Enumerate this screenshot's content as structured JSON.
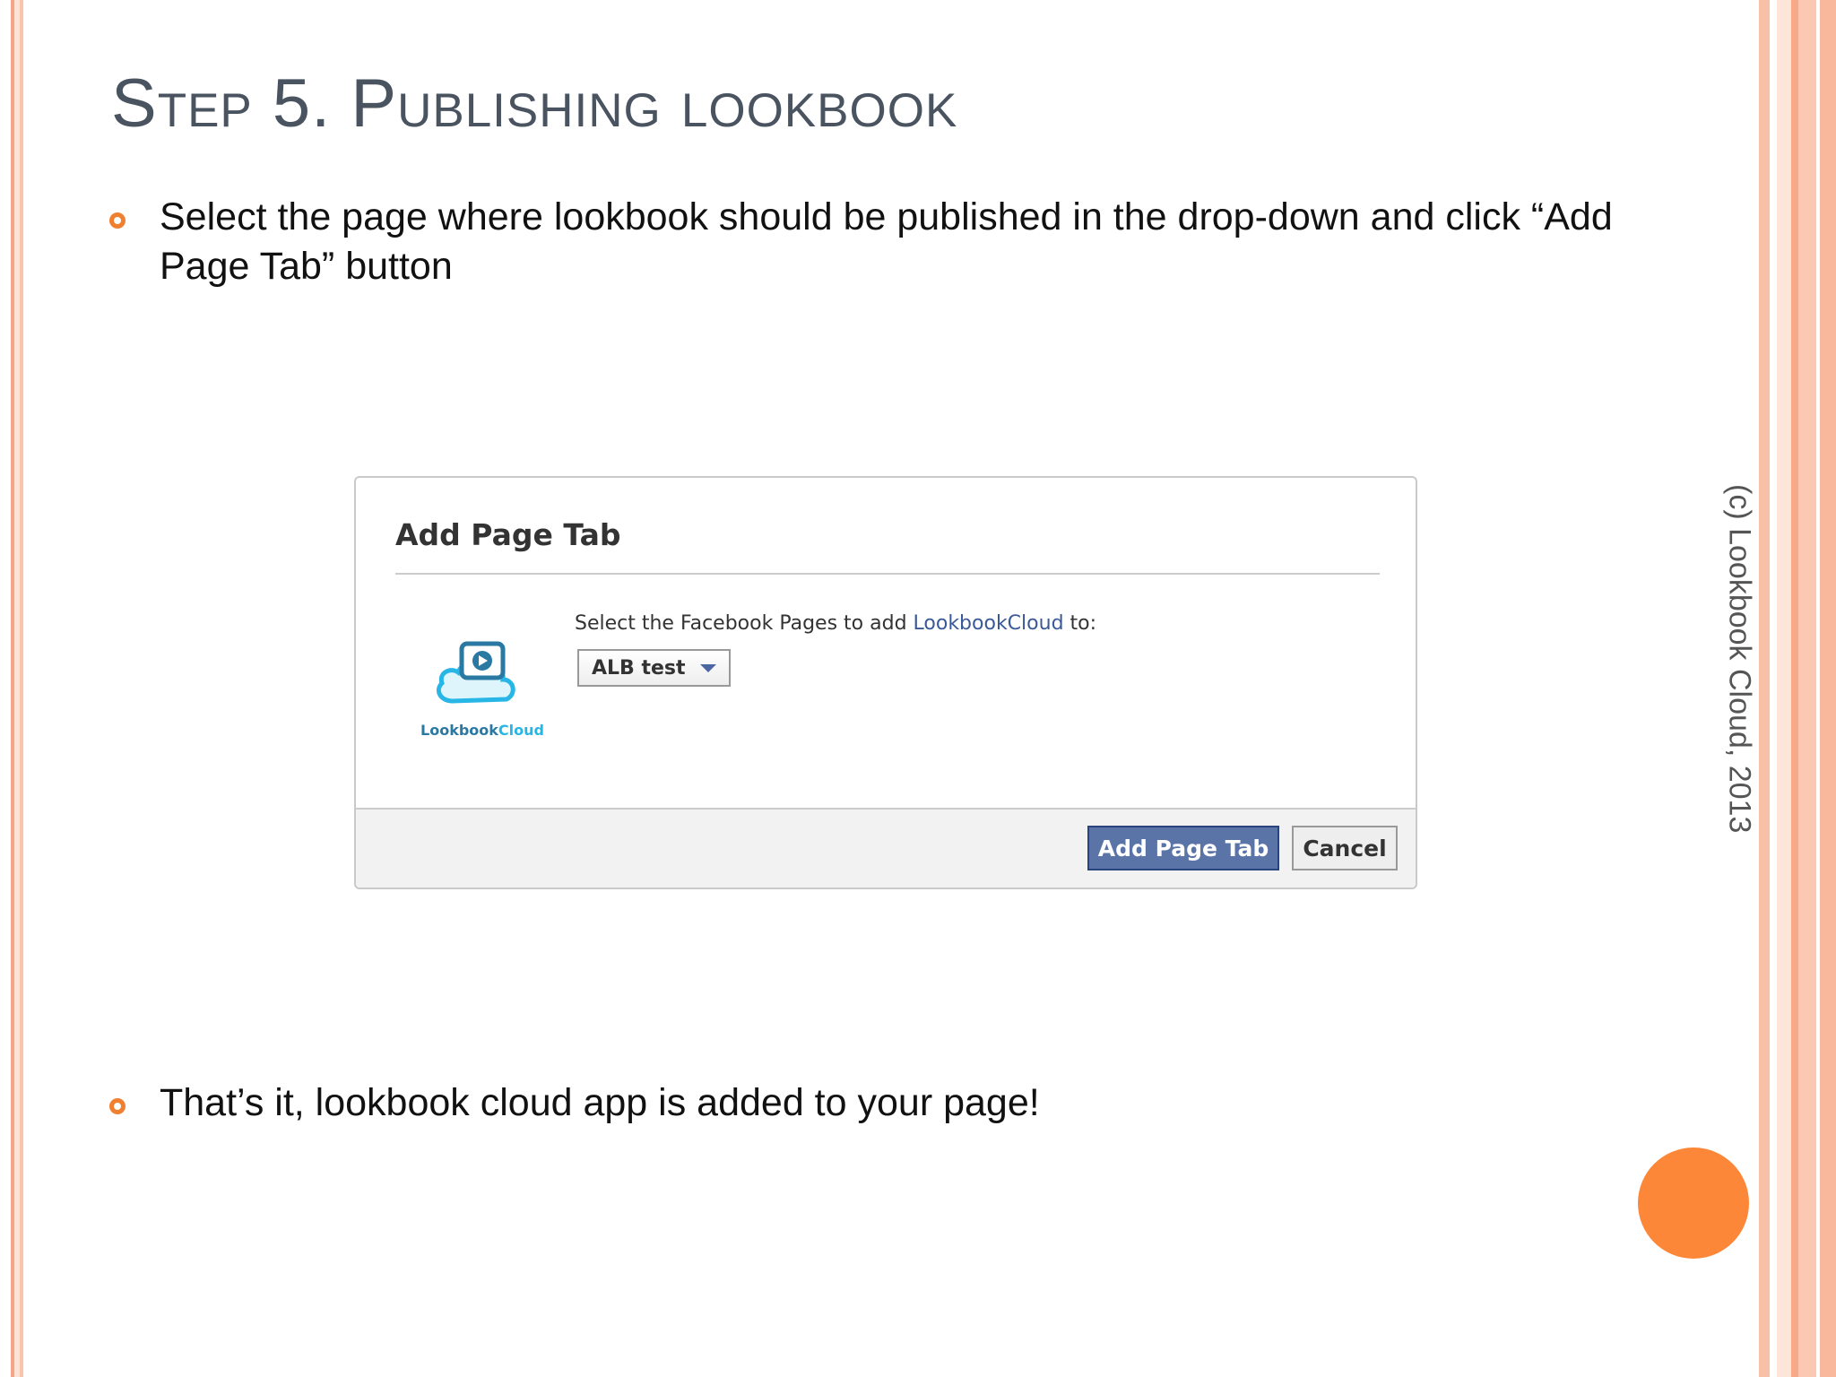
{
  "slide": {
    "title": "Step 5. Publishing lookbook",
    "bullets": [
      "Select the page where lookbook should be published in the drop-down and click “Add Page Tab” button",
      "That’s it, lookbook cloud app is added to your page!"
    ],
    "copyright": "(c) Lookbook Cloud, 2013",
    "colors": {
      "accent": "#fd8739",
      "bullet": "#f07f30",
      "title": "#4a5360"
    }
  },
  "dialog": {
    "title": "Add Page Tab",
    "instruction_prefix": "Select the Facebook Pages to add ",
    "app_name": "LookbookCloud",
    "instruction_suffix": " to:",
    "logo_text_part1": "Lookbook",
    "logo_text_part2": "Cloud",
    "selected_page": "ALB test",
    "primary_button": "Add Page Tab",
    "cancel_button": "Cancel",
    "colors": {
      "primary": "#5b74a8",
      "link": "#3b5998"
    }
  }
}
